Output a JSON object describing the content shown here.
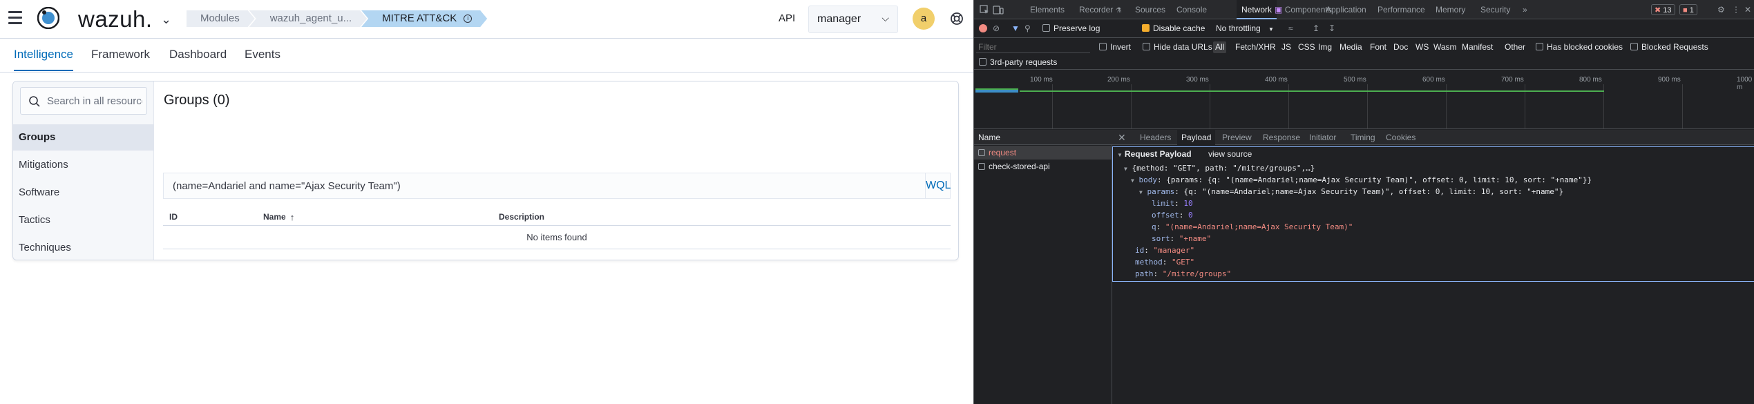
{
  "app": {
    "logo_text": "wazuh.",
    "breadcrumbs": [
      "Modules",
      "wazuh_agent_u...",
      "MITRE ATT&CK"
    ],
    "api_label": "API",
    "api_value": "manager",
    "avatar_letter": "a",
    "tabs": [
      "Intelligence",
      "Framework",
      "Dashboard",
      "Events"
    ],
    "search_placeholder": "Search in all resources",
    "sidebar": [
      "Groups",
      "Mitigations",
      "Software",
      "Tactics",
      "Techniques"
    ],
    "content_title": "Groups (0)",
    "query": "(name=Andariel and name=\"Ajax Security Team\")",
    "wql": "WQL",
    "columns": [
      "ID",
      "Name",
      "Description"
    ],
    "empty_text": "No items found",
    "colors": {
      "accent": "#006bb8",
      "active_crumb": "#b3d6f2",
      "avatar": "#f1cf6b"
    }
  },
  "devtools": {
    "tabs": [
      "Elements",
      "Recorder",
      "Sources",
      "Console",
      "Network",
      "Components",
      "Application",
      "Performance",
      "Memory",
      "Security"
    ],
    "badges": {
      "errors": "13",
      "warnings": "1"
    },
    "toolbar": {
      "preserve_log": "Preserve log",
      "disable_cache": "Disable cache",
      "throttling": "No throttling"
    },
    "filter": {
      "placeholder": "Filter",
      "invert": "Invert",
      "hide_data_urls": "Hide data URLs",
      "types": [
        "All",
        "Fetch/XHR",
        "JS",
        "CSS",
        "Img",
        "Media",
        "Font",
        "Doc",
        "WS",
        "Wasm",
        "Manifest",
        "Other"
      ],
      "blocked_cookies": "Has blocked cookies",
      "blocked_requests": "Blocked Requests",
      "third_party": "3rd-party requests"
    },
    "timeline_ticks": [
      "100 ms",
      "200 ms",
      "300 ms",
      "400 ms",
      "500 ms",
      "600 ms",
      "700 ms",
      "800 ms",
      "900 ms",
      "1000 m"
    ],
    "name_header": "Name",
    "requests": [
      "request",
      "check-stored-api"
    ],
    "detail_tabs": [
      "Headers",
      "Payload",
      "Preview",
      "Response",
      "Initiator",
      "Timing",
      "Cookies"
    ],
    "payload": {
      "title": "Request Payload",
      "view_source": "view source",
      "summary": "{method: \"GET\", path: \"/mitre/groups\",…}",
      "body_summary": "{params: {q: \"(name=Andariel;name=Ajax Security Team)\", offset: 0, limit: 10, sort: \"+name\"}}",
      "params_summary": "{q: \"(name=Andariel;name=Ajax Security Team)\", offset: 0, limit: 10, sort: \"+name\"}",
      "limit": "10",
      "offset": "0",
      "q": "\"(name=Andariel;name=Ajax Security Team)\"",
      "sort": "\"+name\"",
      "id": "\"manager\"",
      "method": "\"GET\"",
      "path": "\"/mitre/groups\""
    }
  }
}
